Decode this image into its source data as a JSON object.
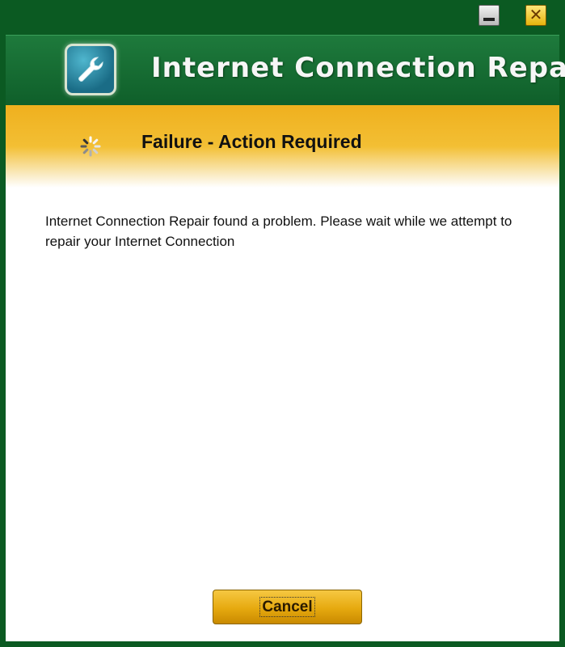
{
  "window": {
    "controls": {
      "minimize_icon": "minimize-icon",
      "close_icon": "close-icon",
      "close_glyph": "✕"
    }
  },
  "header": {
    "icon": "wrench-icon",
    "title": "Internet Connection Repair"
  },
  "status": {
    "icon": "spinner-icon",
    "title": "Failure - Action Required"
  },
  "content": {
    "message": "Internet Connection Repair found a problem. Please wait while we attempt to repair your Internet Connection"
  },
  "footer": {
    "cancel_label": "Cancel"
  },
  "colors": {
    "frame": "#0b5a22",
    "header": "#1e7a3c",
    "banner": "#f3bf34",
    "button": "#e6a90f"
  }
}
